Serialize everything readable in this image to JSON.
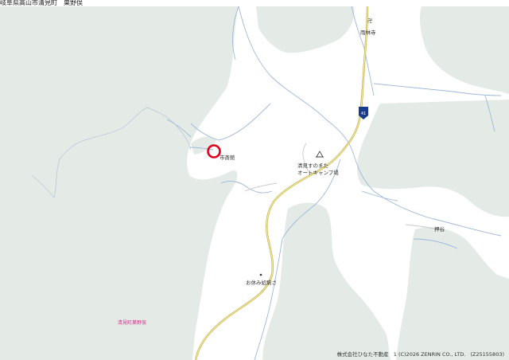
{
  "header": {
    "address": "岐阜県高山市清見町　巣野俣"
  },
  "map_labels": {
    "temple": "雨林寺",
    "temple_symbol": "卍",
    "route": "⛾",
    "route_number": "41",
    "facility_small": "市斎館",
    "campground": "清見すのまた\nオートキャンプ場",
    "campground_line1": "清見すのまた",
    "campground_line2": "オートキャンプ場",
    "east_place": "押谷",
    "rest_area": "お休み処駒さ",
    "district": "清見町巣野俣"
  },
  "footer": {
    "company": "株式会社ひなた不動産",
    "copyright": "1 (C)2026 ZENRIN CO., LTD.",
    "license": "(Z25155803)"
  },
  "colors": {
    "forest": "#e4ebe6",
    "road_major": "#d6c76a",
    "river": "#9fb8d9",
    "marker": "#e0001b",
    "route_shield": "#1a3a8c"
  },
  "icons": [
    "target-marker-icon",
    "temple-icon",
    "route-shield-icon",
    "campground-icon",
    "point-icon"
  ]
}
